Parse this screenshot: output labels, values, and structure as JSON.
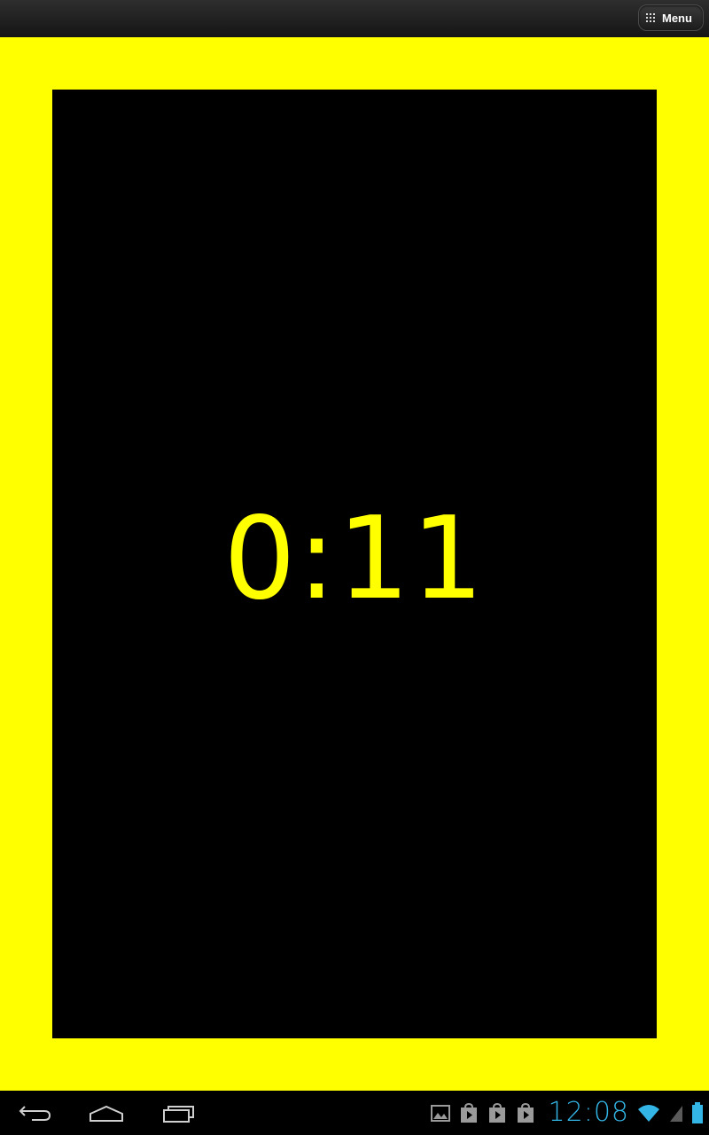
{
  "action_bar": {
    "menu_label": "Menu",
    "menu_icon": "grid-icon"
  },
  "timer": {
    "display": "0:11",
    "text_color": "#ffff00",
    "frame_color": "#ffff00",
    "background_color": "#000000"
  },
  "system_bar": {
    "nav_buttons": [
      "back-icon",
      "home-icon",
      "recent-apps-icon"
    ],
    "notification_icons": [
      "gallery-icon",
      "play-store-icon",
      "play-store-icon",
      "play-store-icon"
    ],
    "clock": "12:08",
    "clock_color": "#33b5e5",
    "status_icons": [
      "wifi-icon",
      "signal-icon",
      "battery-icon"
    ]
  }
}
